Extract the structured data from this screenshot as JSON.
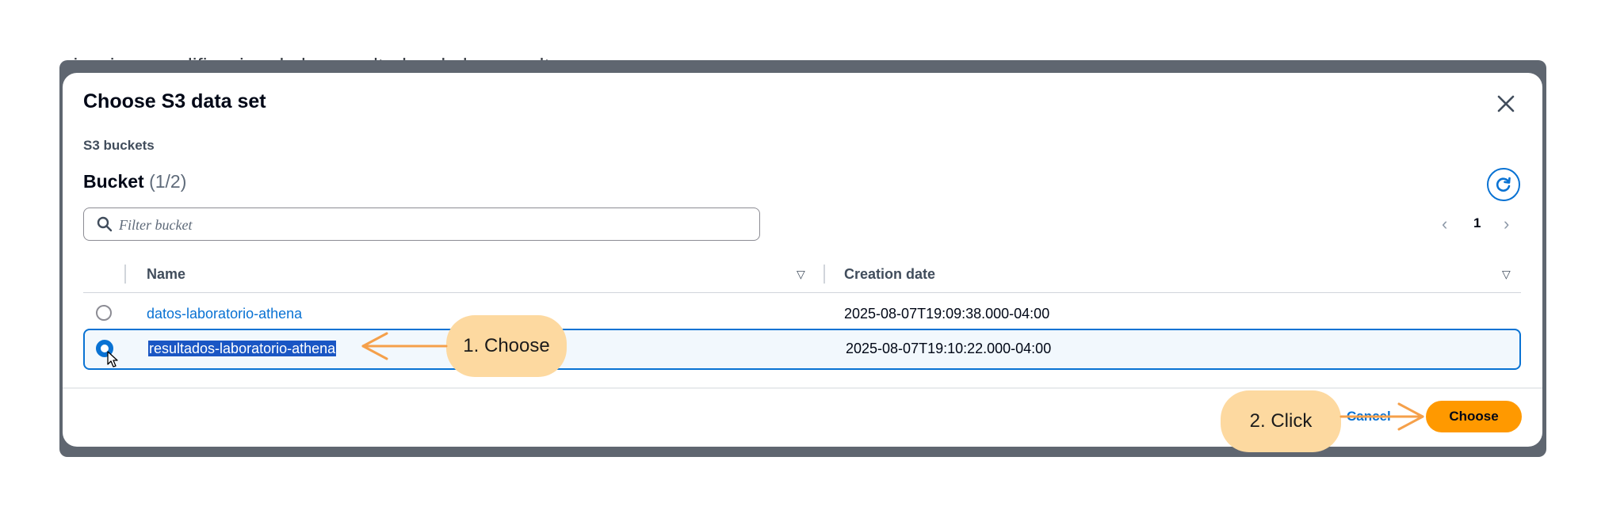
{
  "background_text": "picacion y codificacion de los resultados de la consulta",
  "modal": {
    "title": "Choose S3 data set",
    "section_label": "S3 buckets",
    "bucket_heading": "Bucket",
    "bucket_count": "(1/2)",
    "filter_placeholder": "Filter bucket",
    "pagination": {
      "current_page": "1"
    },
    "columns": {
      "name": "Name",
      "creation_date": "Creation date"
    },
    "rows": [
      {
        "name": "datos-laboratorio-athena",
        "creation_date": "2025-08-07T19:09:38.000-04:00",
        "selected": false
      },
      {
        "name": "resultados-laboratorio-athena",
        "creation_date": "2025-08-07T19:10:22.000-04:00",
        "selected": true
      }
    ],
    "footer": {
      "cancel_label": "Cancel",
      "choose_label": "Choose"
    }
  },
  "annotations": {
    "step1": "1. Choose",
    "step2": "2. Click",
    "color": "#f5a04a"
  },
  "colors": {
    "accent": "#0972d3",
    "primary_button": "#ff9900",
    "backdrop": "#5f6670"
  }
}
